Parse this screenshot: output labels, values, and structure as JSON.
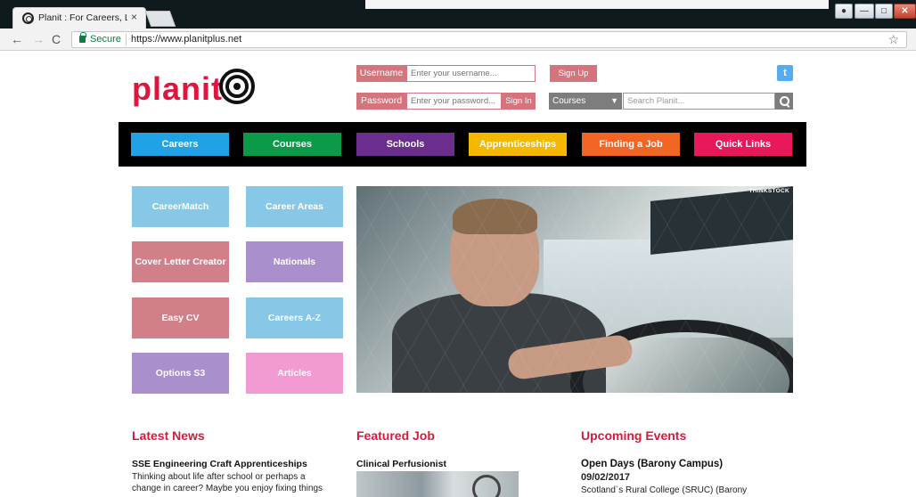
{
  "browser": {
    "tab_title": "Planit : For Careers, Learn",
    "secure_label": "Secure",
    "url": "https://www.planitplus.net",
    "tab_close_glyph": "×"
  },
  "header": {
    "logo_text": "planit",
    "username_label": "Username",
    "username_placeholder": "Enter your username...",
    "password_label": "Password",
    "password_placeholder": "Enter your password...",
    "signin_label": "Sign In",
    "signup_label": "Sign Up",
    "courses_select": "Courses",
    "search_placeholder": "Search Planit..."
  },
  "nav": {
    "items": [
      {
        "label": "Careers",
        "color": "#1fa3e6"
      },
      {
        "label": "Courses",
        "color": "#0a9a48"
      },
      {
        "label": "Schools",
        "color": "#6b2d8e"
      },
      {
        "label": "Apprenticeships",
        "color": "#f5b800"
      },
      {
        "label": "Finding a Job",
        "color": "#f26522"
      },
      {
        "label": "Quick Links",
        "color": "#e8185a"
      }
    ]
  },
  "tiles": [
    {
      "label": "CareerMatch",
      "color": "#87c8e6"
    },
    {
      "label": "Career Areas",
      "color": "#87c8e6"
    },
    {
      "label": "Cover Letter Creator",
      "color": "#d1808a"
    },
    {
      "label": "Nationals",
      "color": "#a98fcc"
    },
    {
      "label": "Easy CV",
      "color": "#d1808a"
    },
    {
      "label": "Careers A-Z",
      "color": "#87c8e6"
    },
    {
      "label": "Options S3",
      "color": "#a98fcc"
    },
    {
      "label": "Articles",
      "color": "#f29ad2"
    }
  ],
  "hero": {
    "credit": "THINKSTOCK"
  },
  "sections": {
    "news": {
      "title": "Latest News",
      "item_title": "SSE Engineering Craft Apprenticeships",
      "item_body_1": "Thinking about life after school or perhaps a",
      "item_body_2": "change in career? Maybe you enjoy fixing things"
    },
    "job": {
      "title": "Featured Job",
      "item_title": "Clinical Perfusionist"
    },
    "events": {
      "title": "Upcoming Events",
      "item_title": "Open Days (Barony Campus)",
      "date": "09/02/2017",
      "body": "Scotland`s Rural College (SRUC) (Barony"
    }
  }
}
